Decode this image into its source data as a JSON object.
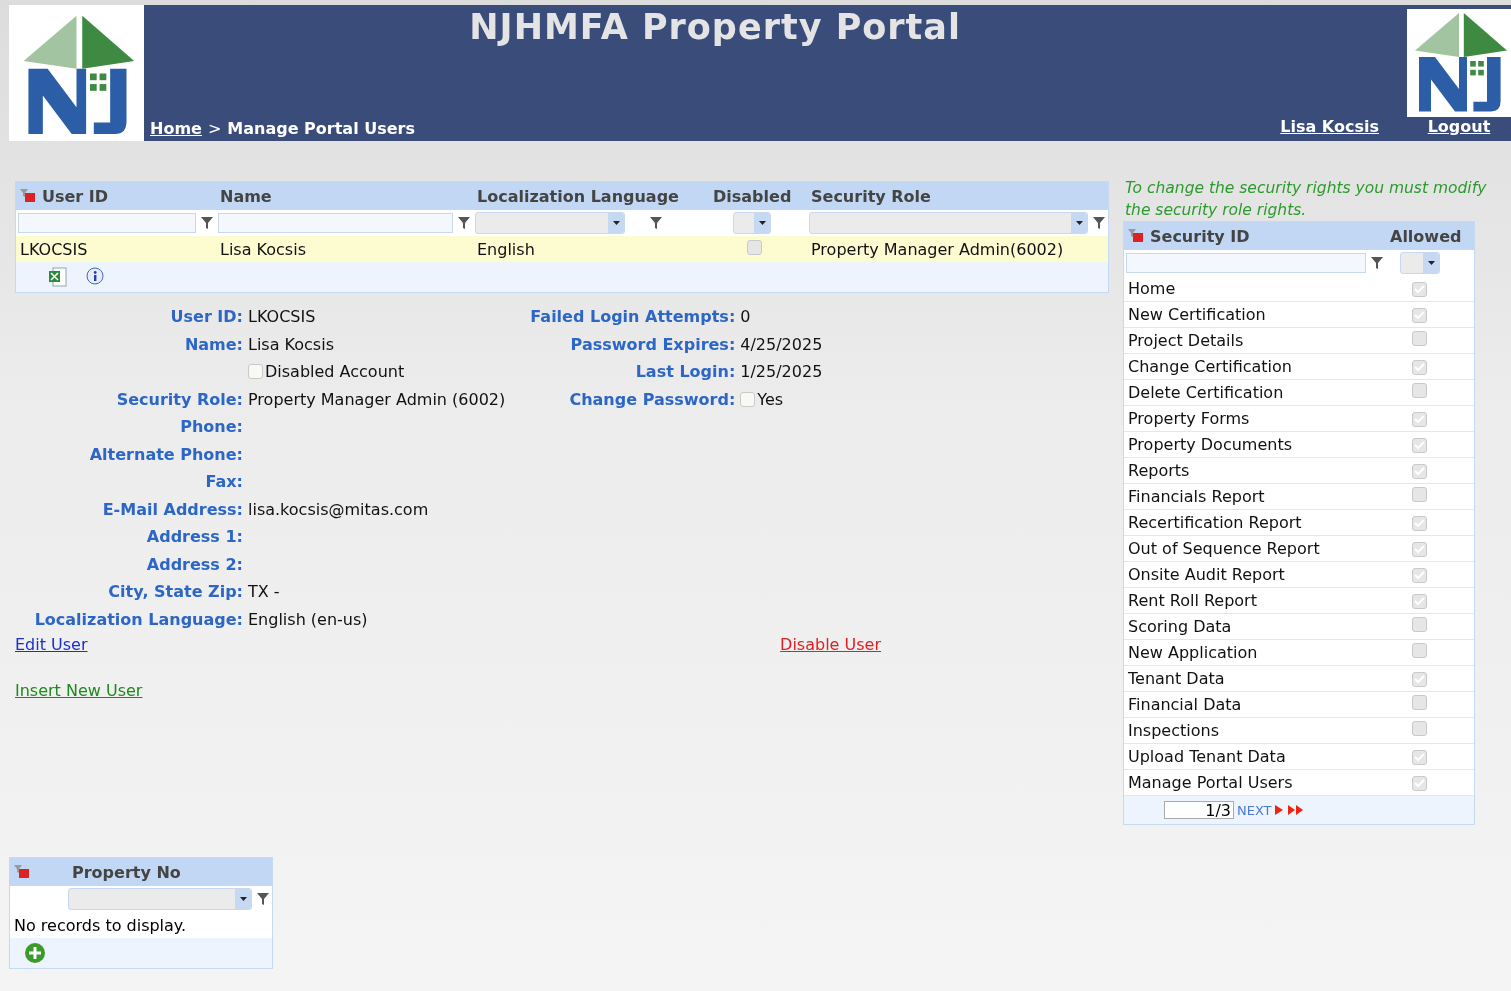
{
  "header": {
    "title": "NJHMFA Property Portal",
    "breadcrumb": {
      "home": "Home",
      "separator": ">",
      "current": "Manage Portal Users"
    },
    "user": "Lisa Kocsis",
    "logout": "Logout"
  },
  "users_grid": {
    "columns": [
      "User ID",
      "Name",
      "Localization Language",
      "Disabled",
      "Security Role"
    ],
    "rows": [
      {
        "user_id": "LKOCSIS",
        "name": "Lisa Kocsis",
        "language": "English",
        "disabled": false,
        "security_role": "Property Manager Admin(6002)",
        "selected": true
      }
    ]
  },
  "details": {
    "left": [
      {
        "kind": "field",
        "label": "User ID:",
        "value": "LKOCSIS"
      },
      {
        "kind": "field",
        "label": "Name:",
        "value": "Lisa Kocsis"
      },
      {
        "kind": "checkbox",
        "value": "Disabled Account",
        "checked": false
      },
      {
        "kind": "field",
        "label": "Security Role:",
        "value": "Property Manager Admin (6002)"
      },
      {
        "kind": "field",
        "label": "Phone:"
      },
      {
        "kind": "field",
        "label": "Alternate Phone:"
      },
      {
        "kind": "field",
        "label": "Fax:"
      },
      {
        "kind": "field",
        "label": "E-Mail Address:",
        "value": "lisa.kocsis@mitas.com"
      },
      {
        "kind": "field",
        "label": "Address 1:"
      },
      {
        "kind": "field",
        "label": "Address 2:"
      },
      {
        "kind": "field",
        "label": "City, State Zip:",
        "value": "TX -"
      },
      {
        "kind": "field",
        "label": "Localization Language:",
        "value": "English (en-us)"
      }
    ],
    "right": [
      {
        "kind": "field",
        "label": "Failed Login Attempts:",
        "value": "0"
      },
      {
        "kind": "field",
        "label": "Password Expires:",
        "value": "4/25/2025"
      },
      {
        "kind": "field",
        "label": "Last Login:",
        "value": "1/25/2025"
      },
      {
        "kind": "checkbox",
        "label": "Change Password:",
        "value": "Yes",
        "checked": false
      }
    ]
  },
  "links": {
    "edit_user": "Edit User",
    "disable_user": "Disable User",
    "insert_new_user": "Insert New User"
  },
  "security": {
    "note": "To change the security rights you must modify the security role rights.",
    "columns": [
      "Security ID",
      "Allowed"
    ],
    "rows": [
      {
        "label": "Home",
        "allowed": true
      },
      {
        "label": "New Certification",
        "allowed": true
      },
      {
        "label": "Project Details",
        "allowed": false
      },
      {
        "label": "Change Certification",
        "allowed": true
      },
      {
        "label": "Delete Certification",
        "allowed": false
      },
      {
        "label": "Property Forms",
        "allowed": true
      },
      {
        "label": "Property Documents",
        "allowed": true
      },
      {
        "label": "Reports",
        "allowed": true
      },
      {
        "label": "Financials Report",
        "allowed": false
      },
      {
        "label": "Recertification Report",
        "allowed": true
      },
      {
        "label": "Out of Sequence Report",
        "allowed": true
      },
      {
        "label": "Onsite Audit Report",
        "allowed": true
      },
      {
        "label": "Rent Roll Report",
        "allowed": true
      },
      {
        "label": "Scoring Data",
        "allowed": false
      },
      {
        "label": "New Application",
        "allowed": false
      },
      {
        "label": "Tenant Data",
        "allowed": true
      },
      {
        "label": "Financial Data",
        "allowed": false
      },
      {
        "label": "Inspections",
        "allowed": false
      },
      {
        "label": "Upload Tenant Data",
        "allowed": true
      },
      {
        "label": "Manage Portal Users",
        "allowed": true
      }
    ],
    "pager": {
      "page": "1/3",
      "next": "NEXT"
    }
  },
  "property_grid": {
    "column": "Property No",
    "empty": "No records to display."
  }
}
